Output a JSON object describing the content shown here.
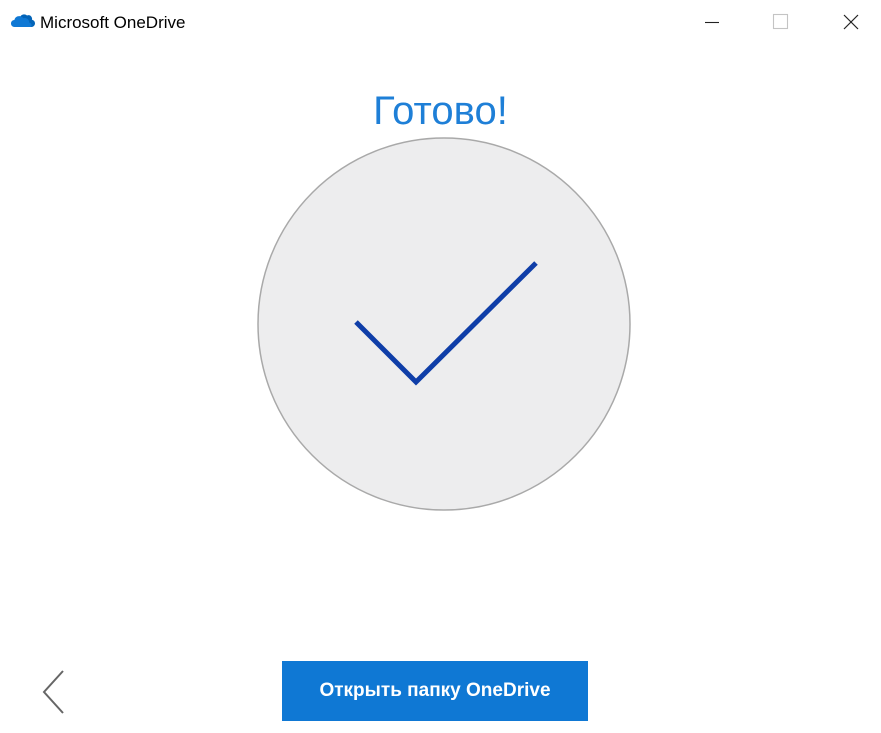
{
  "window": {
    "title": "Microsoft OneDrive",
    "icon": "onedrive-cloud-icon",
    "controls": {
      "minimize": "minimize-icon",
      "maximize": "maximize-icon",
      "close": "close-icon"
    }
  },
  "main": {
    "heading": "Готово!",
    "status_icon": "checkmark-icon",
    "primary_button_label": "Открыть папку OneDrive",
    "back_icon": "chevron-left-icon"
  },
  "colors": {
    "accent": "#0f78d4",
    "heading": "#1e7fd7",
    "checkmark": "#0f3ea8",
    "circle_fill": "#ededee",
    "circle_border": "#a9a9a9",
    "icon_gray": "#666666"
  }
}
